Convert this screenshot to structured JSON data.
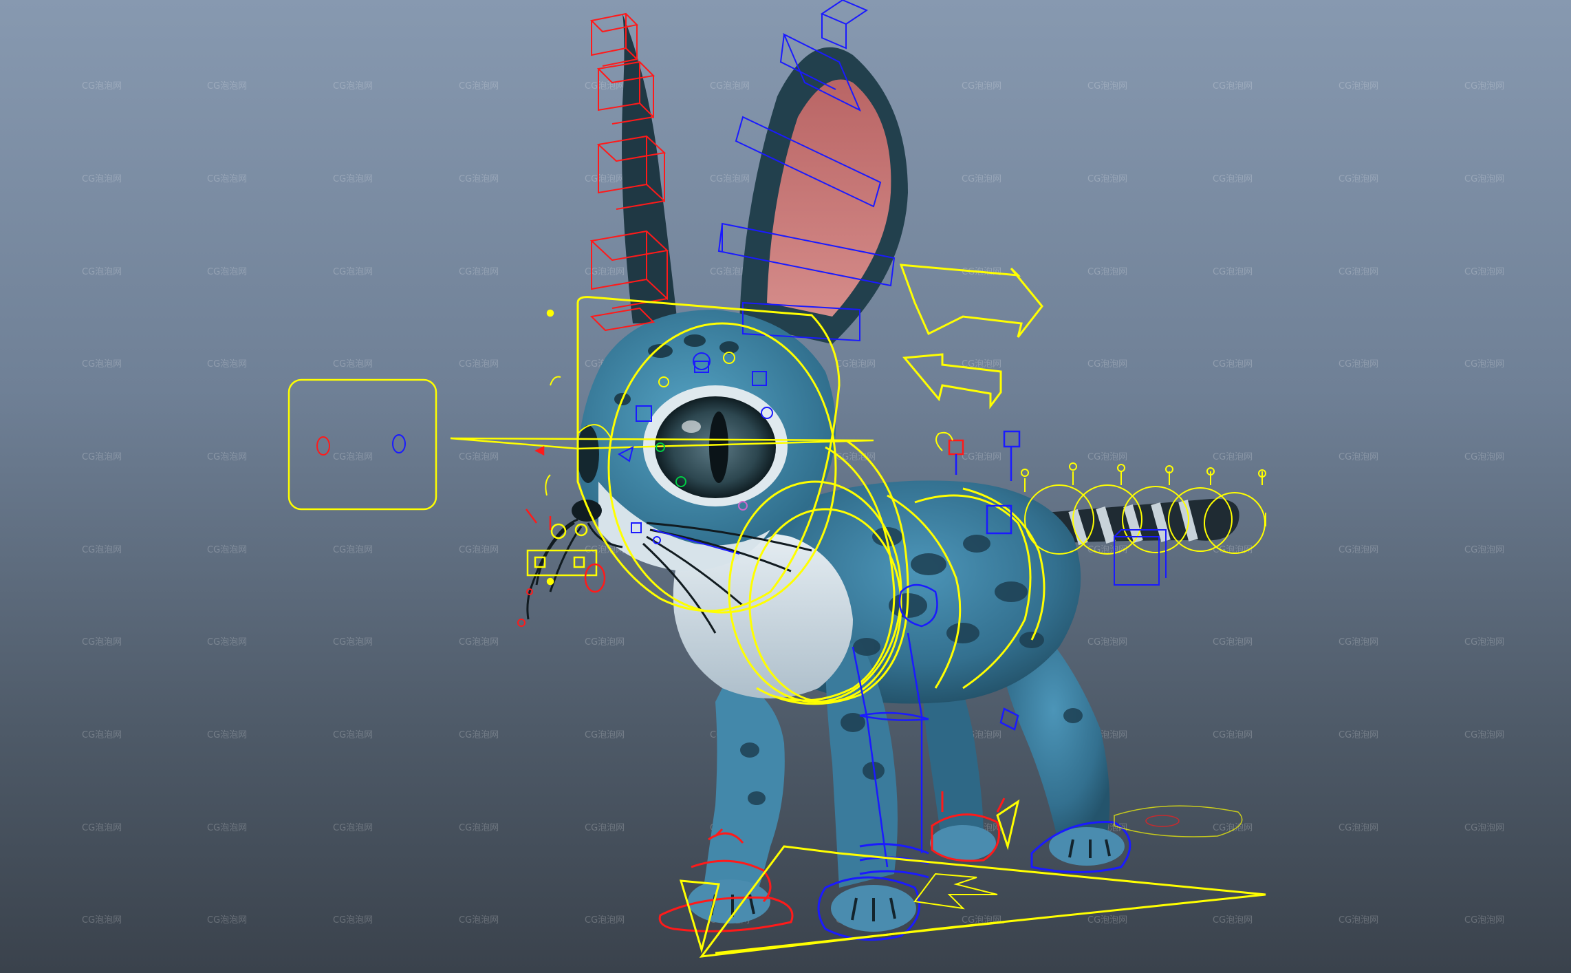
{
  "viewport": {
    "background_top": "#8799b0",
    "background_bottom": "#3a424c"
  },
  "watermark": {
    "text": "CG泡泡网",
    "columns": 12,
    "rows": 10
  },
  "colors": {
    "ik_controls": "#ffff00",
    "fk_controls": "#1a1aff",
    "left_side_controls": "#ff1a1a",
    "fur_body": "#3b7fa0",
    "fur_belly": "#d0dde6",
    "ear_inner": "#c97a7a",
    "spots": "#1d3f52"
  },
  "scene_objects": [
    "character-mesh",
    "eye-look-control",
    "head-control",
    "ear-fk-controls",
    "tail-fk-controls",
    "foot-ik-controls",
    "main-ground-control"
  ]
}
